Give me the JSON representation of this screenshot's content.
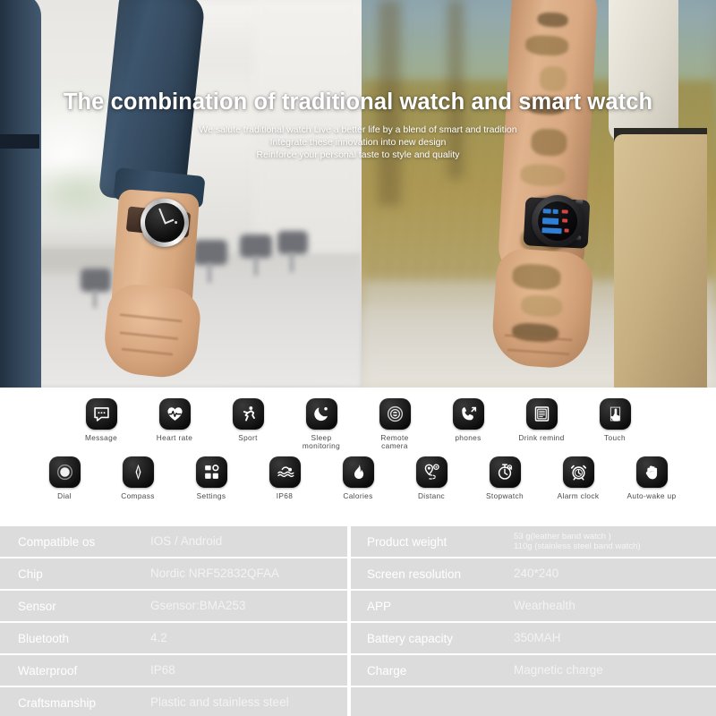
{
  "hero": {
    "title": "The combination of traditional watch and smart watch",
    "subtitle_lines": [
      "We salute traditional watch  Live a better life by a blend of smart and tradition",
      "Integrate these innovation into new design",
      "Reinforce your personal taste to style and quality"
    ]
  },
  "features": {
    "row1": [
      {
        "icon": "message-icon",
        "label": "Message"
      },
      {
        "icon": "heart-rate-icon",
        "label": "Heart rate"
      },
      {
        "icon": "sport-icon",
        "label": "Sport"
      },
      {
        "icon": "sleep-monitoring-icon",
        "label": "Sleep\nmonitoring"
      },
      {
        "icon": "remote-camera-icon",
        "label": "Remote\ncamera"
      },
      {
        "icon": "phone-icon",
        "label": "phones"
      },
      {
        "icon": "drink-remind-icon",
        "label": "Drink remind"
      },
      {
        "icon": "touch-icon",
        "label": "Touch"
      }
    ],
    "row2": [
      {
        "icon": "dial-icon",
        "label": "Dial"
      },
      {
        "icon": "compass-icon",
        "label": "Compass"
      },
      {
        "icon": "settings-icon",
        "label": "Settings"
      },
      {
        "icon": "waterproof-ip68-icon",
        "label": "IP68"
      },
      {
        "icon": "calories-flame-icon",
        "label": "Calories"
      },
      {
        "icon": "distance-pin-icon",
        "label": "Distanc"
      },
      {
        "icon": "stopwatch-icon",
        "label": "Stopwatch"
      },
      {
        "icon": "alarm-clock-icon",
        "label": "Alarm clock"
      },
      {
        "icon": "auto-wake-hand-icon",
        "label": "Auto-wake up"
      }
    ]
  },
  "spec_table": {
    "rows": [
      {
        "left": {
          "key": "Compatible os",
          "value": "IOS / Android"
        },
        "right": {
          "key": "Product weight",
          "value": "53 g(leather band watch )\n110g (stainless steel band watch)",
          "two_line": true
        }
      },
      {
        "left": {
          "key": "Chip",
          "value": "Nordic NRF52832QFAA"
        },
        "right": {
          "key": "Screen resolution",
          "value": "240*240"
        }
      },
      {
        "left": {
          "key": "Sensor",
          "value": "Gsensor:BMA253"
        },
        "right": {
          "key": "APP",
          "value": "Wearhealth"
        }
      },
      {
        "left": {
          "key": "Bluetooth",
          "value": "4.2"
        },
        "right": {
          "key": "Battery capacity",
          "value": "350MAH"
        }
      },
      {
        "left": {
          "key": "Waterproof",
          "value": "IP68"
        },
        "right": {
          "key": "Charge",
          "value": "Magnetic charge"
        }
      },
      {
        "left": {
          "key": "Craftsmanship",
          "value": "Plastic and stainless steel"
        },
        "right": {
          "key": "",
          "value": ""
        }
      }
    ]
  },
  "colors": {
    "table_row_bg": "#dcdcdc",
    "table_text": "#ffffff",
    "icon_tile_bg": "#111111",
    "icon_label": "#4a4a4a",
    "page_bg": "#ffffff"
  }
}
